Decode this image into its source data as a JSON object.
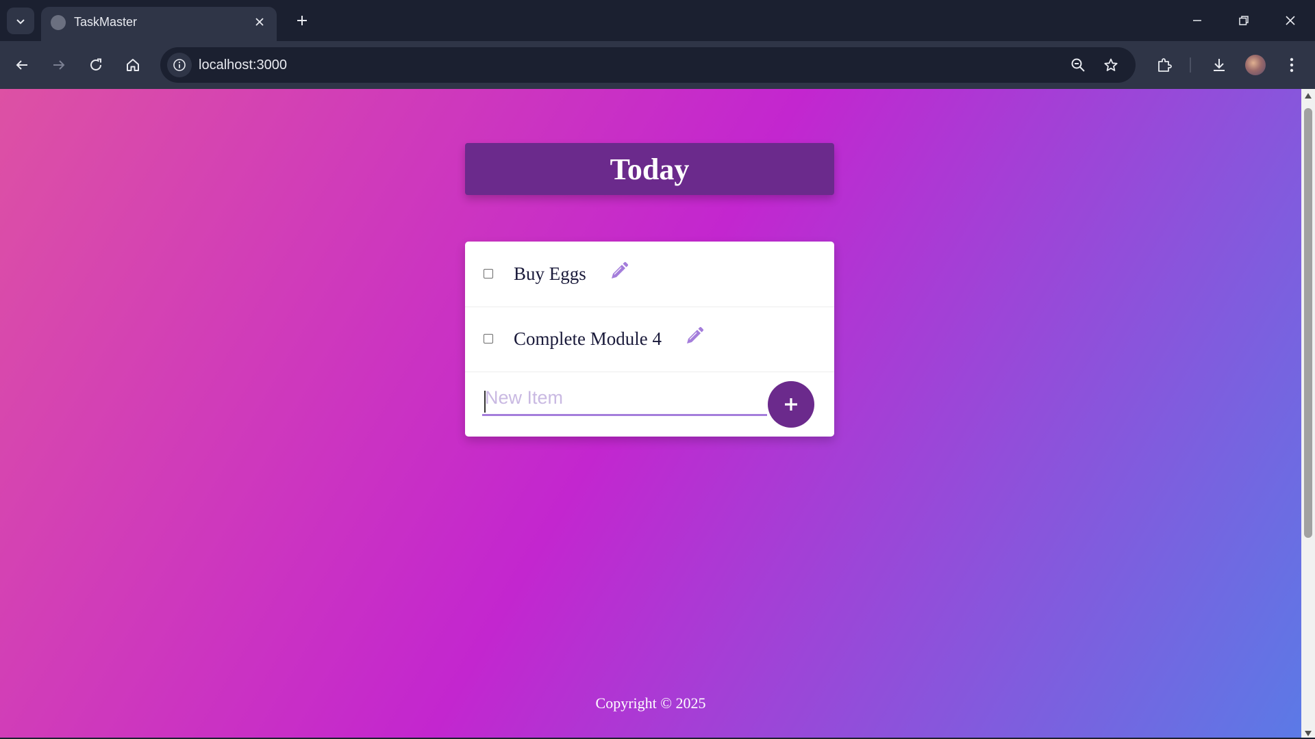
{
  "browser": {
    "tab": {
      "title": "TaskMaster",
      "favicon": "globe-icon"
    },
    "address": {
      "url": "localhost:3000"
    },
    "icons": [
      "tab-search-icon",
      "close-icon",
      "plus-icon",
      "minimize-icon",
      "restore-icon",
      "window-close-icon",
      "back-arrow-icon",
      "forward-arrow-icon",
      "reload-icon",
      "home-icon",
      "info-icon",
      "zoom-out-icon",
      "star-icon",
      "extensions-icon",
      "download-icon",
      "avatar",
      "more-vert-icon"
    ]
  },
  "app": {
    "heading": "Today",
    "items": [
      {
        "label": "Buy Eggs",
        "checked": false
      },
      {
        "label": "Complete Module 4",
        "checked": false
      }
    ],
    "new_item": {
      "placeholder": "New Item",
      "value": ""
    },
    "add_button": {
      "label": "+"
    },
    "footer": "Copyright © 2025"
  },
  "colors": {
    "accent": "#6b2a8c",
    "pencil": "#a47ddb",
    "gradient_start": "#dd51a4",
    "gradient_mid": "#c326cf",
    "gradient_end": "#5b7ae6"
  }
}
